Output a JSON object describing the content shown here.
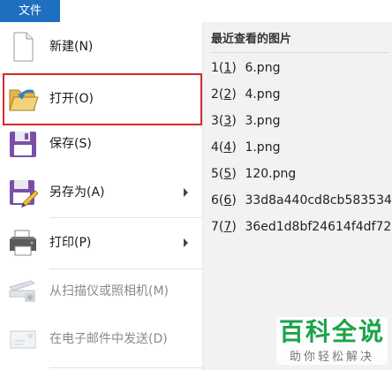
{
  "tab": {
    "file_label": "文件"
  },
  "menu": {
    "items": [
      {
        "label": "新建(N)",
        "icon": "new-document-icon"
      },
      {
        "label": "打开(O)",
        "icon": "open-folder-icon"
      },
      {
        "label": "保存(S)",
        "icon": "save-floppy-icon"
      },
      {
        "label": "另存为(A)",
        "icon": "save-as-icon"
      },
      {
        "label": "打印(P)",
        "icon": "printer-icon"
      },
      {
        "label": "从扫描仪或照相机(M)",
        "icon": "scanner-icon"
      },
      {
        "label": "在电子邮件中发送(D)",
        "icon": "email-icon"
      }
    ]
  },
  "recent": {
    "title": "最近查看的图片",
    "items": [
      {
        "num": "1",
        "label": "6.png"
      },
      {
        "num": "2",
        "label": "4.png"
      },
      {
        "num": "3",
        "label": "3.png"
      },
      {
        "num": "4",
        "label": "1.png"
      },
      {
        "num": "5",
        "label": "120.png"
      },
      {
        "num": "6",
        "label": "33d8a440cd8cb583534"
      },
      {
        "num": "7",
        "label": "36ed1d8bf24614f4df72"
      }
    ]
  },
  "watermark": {
    "main": "百科全说",
    "sub": "助你轻松解决"
  },
  "colors": {
    "accent": "#1e6fc0",
    "highlight_border": "#d42a2a",
    "watermark_green": "#1ca34a"
  }
}
